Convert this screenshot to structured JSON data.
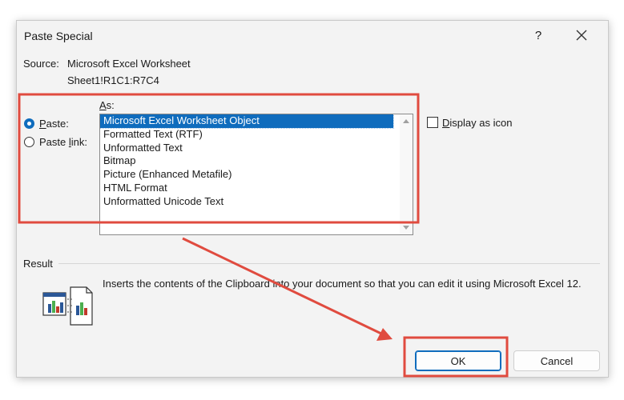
{
  "dialog": {
    "title": "Paste Special",
    "help_label": "?",
    "close_icon": "close-icon"
  },
  "source": {
    "label": "Source:",
    "value": "Microsoft Excel Worksheet",
    "range": "Sheet1!R1C1:R7C4"
  },
  "paste_options": {
    "as_label": "As:",
    "paste_label": "Paste:",
    "paste_link_label": "Paste link:",
    "selected": "paste"
  },
  "list": {
    "items": [
      "Microsoft Excel Worksheet Object",
      "Formatted Text (RTF)",
      "Unformatted Text",
      "Bitmap",
      "Picture (Enhanced Metafile)",
      "HTML Format",
      "Unformatted Unicode Text"
    ],
    "selected_index": 0
  },
  "display_as_icon": {
    "label": "Display as icon",
    "checked": false
  },
  "result": {
    "label": "Result",
    "text": "Inserts the contents of the Clipboard into your document so that you can edit it using Microsoft Excel 12.",
    "icon": "paste-result-icon"
  },
  "buttons": {
    "ok": "OK",
    "cancel": "Cancel"
  },
  "annotation": {
    "color": "#e04b3f"
  },
  "colors": {
    "accent": "#0f6cbd",
    "dialog_bg": "#f3f3f3"
  }
}
